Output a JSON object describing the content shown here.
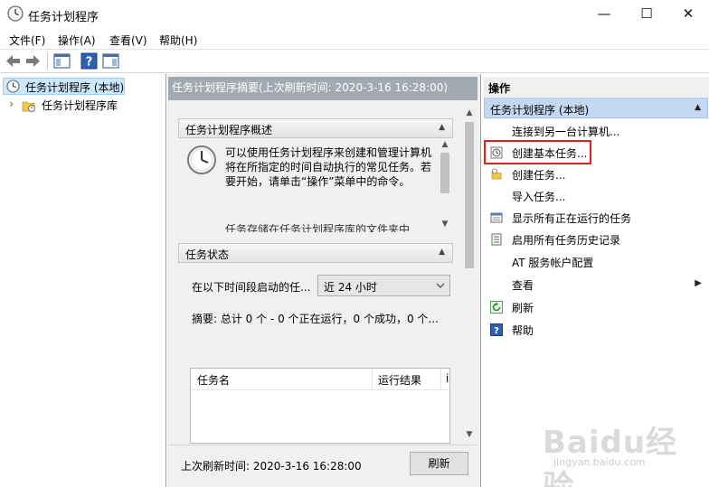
{
  "window": {
    "title": "任务计划程序",
    "minimize_glyph": "—",
    "maximize_glyph": "☐",
    "close_glyph": "✕"
  },
  "menu": [
    "文件(F)",
    "操作(A)",
    "查看(V)",
    "帮助(H)"
  ],
  "tree": {
    "root_label": "任务计划程序 (本地)",
    "child_label": "任务计划程序库",
    "expander_glyph": "›"
  },
  "middle": {
    "header": "任务计划程序摘要(上次刷新时间: 2020-3-16 16:28:00)",
    "overview": {
      "title": "任务计划程序概述",
      "text": "可以使用任务计划程序来创建和管理计算机将在所指定的时间自动执行的常见任务。若要开始，请单击“操作”菜单中的命令。",
      "text_more": "任务存储在任务计划程序库的文件夹中"
    },
    "status": {
      "title": "任务状态",
      "filter_label": "在以下时间段启动的任...",
      "filter_value": "近 24 小时",
      "summary": "摘要: 总计 0 个 - 0 个正在运行，0 个成功，0 个...",
      "columns": [
        "任务名",
        "运行结果",
        "i"
      ]
    },
    "footer": {
      "refresh_time": "上次刷新时间: 2020-3-16 16:28:00",
      "refresh_button": "刷新"
    },
    "collapse_glyph": "▲"
  },
  "actions": {
    "title": "操作",
    "group": "任务计划程序 (本地)",
    "items": [
      {
        "label": "连接到另一台计算机...",
        "icon": "none"
      },
      {
        "label": "创建基本任务...",
        "icon": "create-basic-task-icon"
      },
      {
        "label": "创建任务...",
        "icon": "create-task-icon"
      },
      {
        "label": "导入任务...",
        "icon": "none"
      },
      {
        "label": "显示所有正在运行的任务",
        "icon": "running-tasks-icon"
      },
      {
        "label": "启用所有任务历史记录",
        "icon": "history-icon"
      },
      {
        "label": "AT 服务帐户配置",
        "icon": "none"
      },
      {
        "label": "查看",
        "icon": "none"
      },
      {
        "label": "刷新",
        "icon": "refresh-icon"
      },
      {
        "label": "帮助",
        "icon": "help-icon"
      }
    ],
    "submenu_glyph": "▶",
    "collapse_glyph": "▲"
  },
  "colors": {
    "highlight_box": "#e0201b",
    "selection": "#cce8ff",
    "group_header": "#c4d9f1",
    "middle_header": "#a3a9b0"
  },
  "watermark": {
    "text": "Baidu经验",
    "sub": "jingyan.baidu.com"
  }
}
